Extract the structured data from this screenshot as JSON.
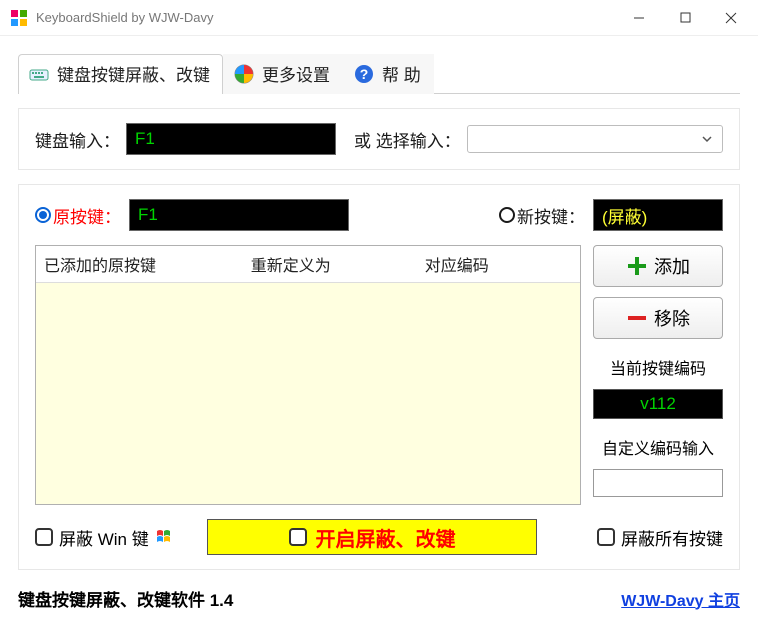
{
  "window": {
    "title": "KeyboardShield by WJW-Davy"
  },
  "tabs": [
    {
      "label": "键盘按键屏蔽、改键"
    },
    {
      "label": "更多设置"
    },
    {
      "label": "帮 助"
    }
  ],
  "input_row": {
    "label": "键盘输入：",
    "value": "F1",
    "or_select_label": "或 选择输入：",
    "select_value": ""
  },
  "radio_row": {
    "original_label": "原按键：",
    "original_value": "F1",
    "new_label": "新按键：",
    "new_value": "(屏蔽)"
  },
  "list": {
    "col1": "已添加的原按键",
    "col2": "重新定义为",
    "col3": "对应编码"
  },
  "side": {
    "add": "添加",
    "remove": "移除",
    "current_code_label": "当前按键编码",
    "current_code_value": "v112",
    "custom_code_label": "自定义编码输入",
    "custom_code_value": ""
  },
  "bottom": {
    "shield_win": "屏蔽 Win 键",
    "main_toggle": "开启屏蔽、改键",
    "shield_all": "屏蔽所有按键"
  },
  "footer": {
    "version": "键盘按键屏蔽、改键软件 1.4",
    "homepage": "WJW-Davy 主页"
  }
}
